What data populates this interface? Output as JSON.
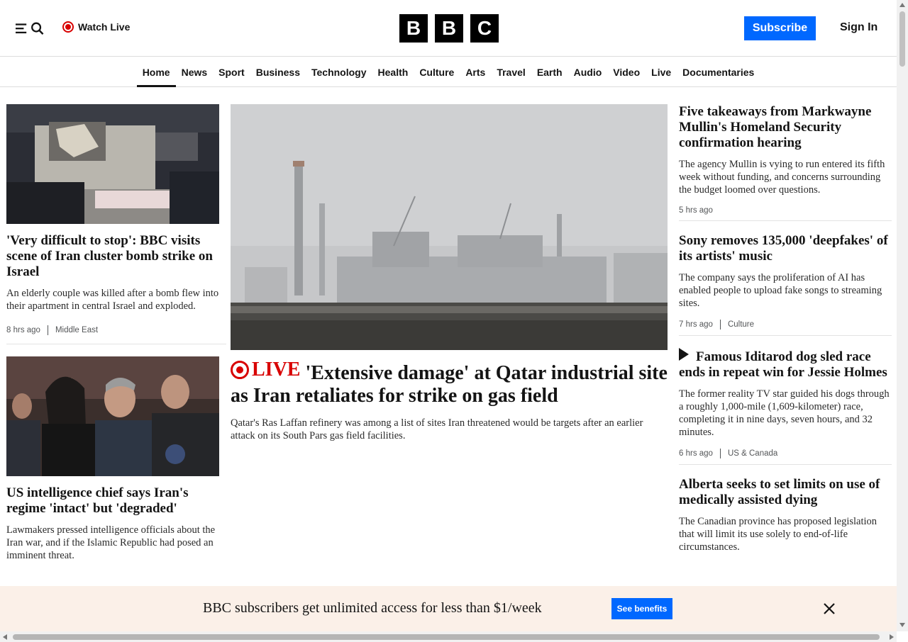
{
  "header": {
    "watch_live_label": "Watch Live",
    "logo_letters": [
      "B",
      "B",
      "C"
    ],
    "subscribe_label": "Subscribe",
    "signin_label": "Sign In"
  },
  "nav": {
    "items": [
      "Home",
      "News",
      "Sport",
      "Business",
      "Technology",
      "Health",
      "Culture",
      "Arts",
      "Travel",
      "Earth",
      "Audio",
      "Video",
      "Live",
      "Documentaries"
    ],
    "active": "Home"
  },
  "left": {
    "card1": {
      "headline": "'Very difficult to stop': BBC visits scene of Iran cluster bomb strike on Israel",
      "summary": "An elderly couple was killed after a bomb flew into their apartment in central Israel and exploded.",
      "time": "8 hrs ago",
      "tag": "Middle East"
    },
    "card2": {
      "headline": "US intelligence chief says Iran's regime 'intact' but 'degraded'",
      "summary": "Lawmakers pressed intelligence officials about the Iran war, and if the Islamic Republic had posed an imminent threat."
    }
  },
  "main": {
    "live_label": "LIVE",
    "headline": "'Extensive damage' at Qatar industrial site as Iran retaliates for strike on gas field",
    "summary": "Qatar's Ras Laffan refinery was among a list of sites Iran threatened would be targets after an earlier attack on its South Pars gas field facilities."
  },
  "right": {
    "card1": {
      "headline": "Five takeaways from Markwayne Mullin's Homeland Security confirmation hearing",
      "summary": "The agency Mullin is vying to run entered its fifth week without funding, and concerns surrounding the budget loomed over questions.",
      "time": "5 hrs ago"
    },
    "card2": {
      "headline": "Sony removes 135,000 'deepfakes' of its artists' music",
      "summary": "The company says the proliferation of AI has enabled people to upload fake songs to streaming sites.",
      "time": "7 hrs ago",
      "tag": "Culture"
    },
    "card3": {
      "headline": "Famous Iditarod dog sled race ends in repeat win for Jessie Holmes",
      "summary": "The former reality TV star guided his dogs through a roughly 1,000-mile (1,609-kilometer) race, completing it in nine days, seven hours, and 32 minutes.",
      "time": "6 hrs ago",
      "tag": "US & Canada"
    },
    "card4": {
      "headline": "Alberta seeks to set limits on use of medically assisted dying",
      "summary": "The Canadian province has proposed legislation that will limit its use solely to end-of-life circumstances."
    }
  },
  "banner": {
    "text": "BBC subscribers get unlimited access for less than $1/week",
    "button_label": "See benefits"
  },
  "colors": {
    "accent_blue": "#0068ff",
    "live_red": "#d80000",
    "banner_bg": "#fbf0e8"
  },
  "icons": [
    "menu-icon",
    "search-icon",
    "live-icon",
    "play-icon",
    "close-icon"
  ]
}
